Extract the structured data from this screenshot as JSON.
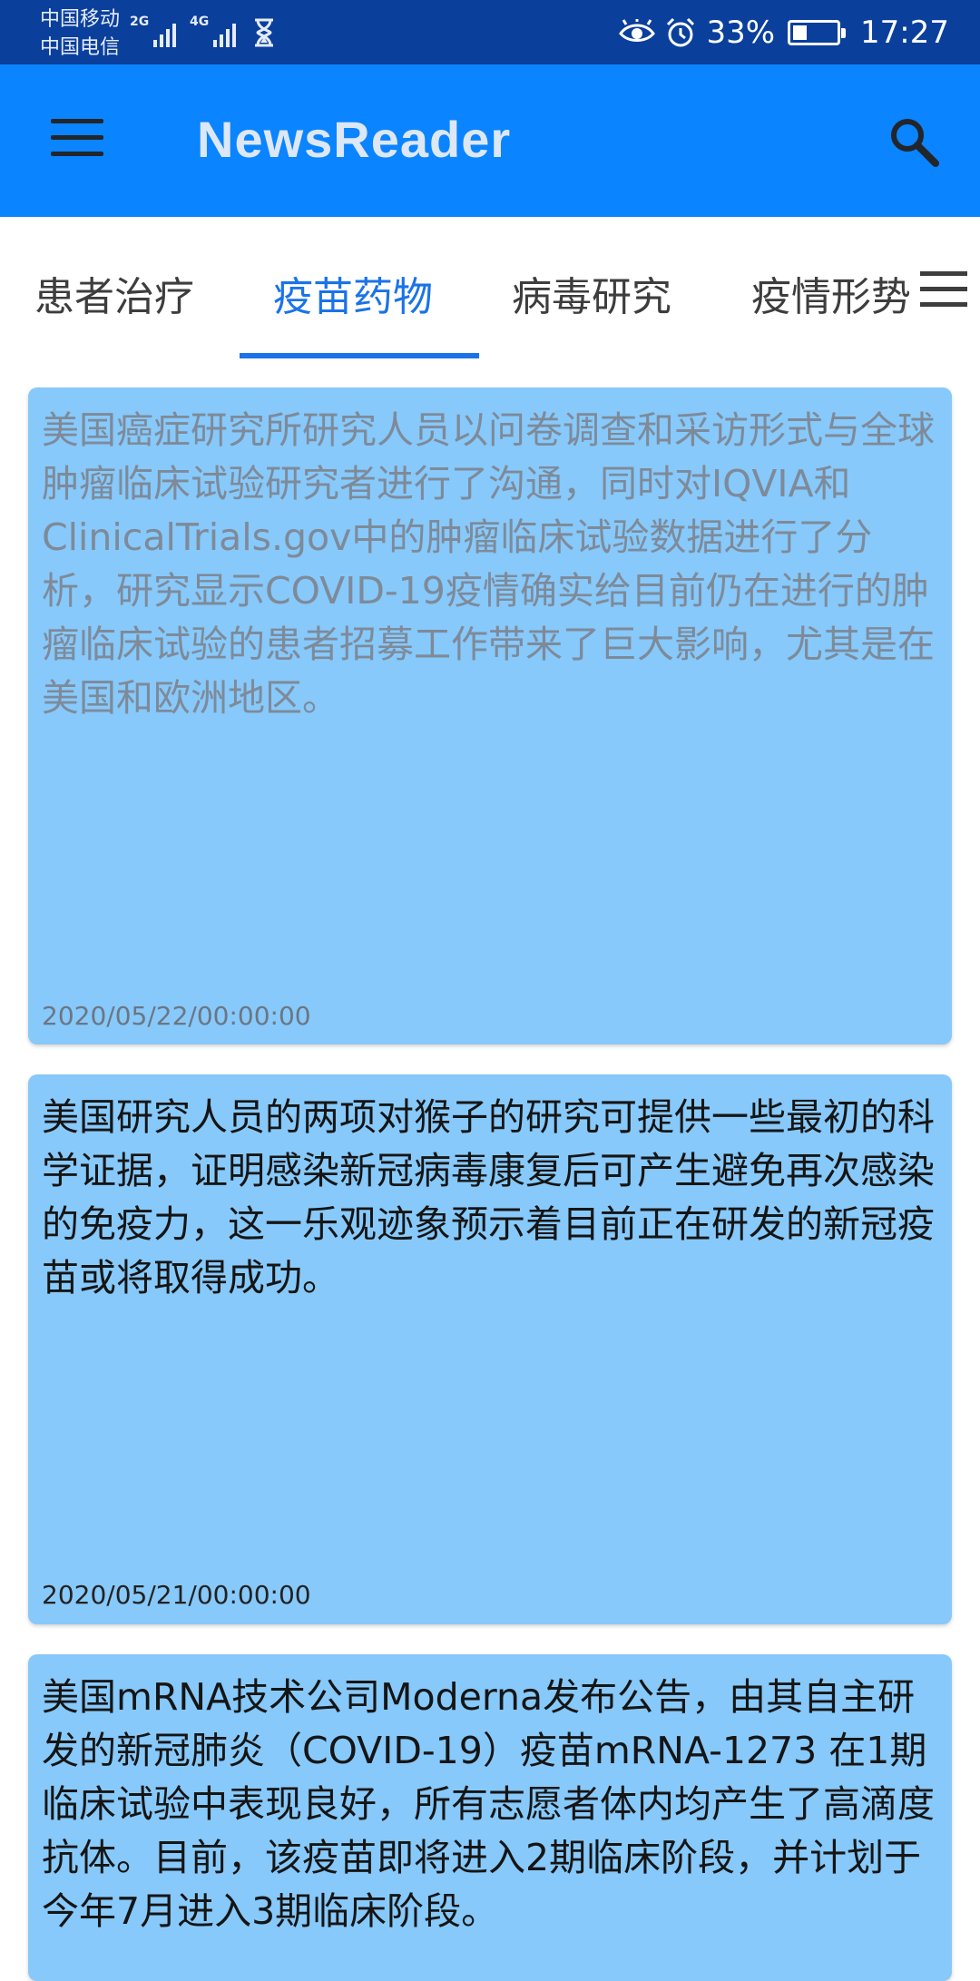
{
  "status_bar": {
    "carrier_1": "中国移动",
    "carrier_2": "中国电信",
    "net_1": "2G",
    "net_2": "4G",
    "battery_percent": "33%",
    "battery_level": 0.33,
    "time": "17:27"
  },
  "app_bar": {
    "title": "NewsReader",
    "menu_icon": "hamburger-menu-icon",
    "search_icon": "search-icon"
  },
  "tabs": {
    "items": [
      {
        "label": "患者治疗"
      },
      {
        "label": "疫苗药物"
      },
      {
        "label": "病毒研究"
      },
      {
        "label": "疫情形势"
      }
    ],
    "active_index": 1,
    "more_icon": "hamburger-menu-icon"
  },
  "news": {
    "items": [
      {
        "content": "美国癌症研究所研究人员以问卷调查和采访形式与全球肿瘤临床试验研究者进行了沟通，同时对IQVIA和ClinicalTrials.gov中的肿瘤临床试验数据进行了分析，研究显示COVID-19疫情确实给目前仍在进行的肿瘤临床试验的患者招募工作带来了巨大影响，尤其是在美国和欧洲地区。",
        "date": "2020/05/22/00:00:00",
        "read": true
      },
      {
        "content": "美国研究人员的两项对猴子的研究可提供一些最初的科学证据，证明感染新冠病毒康复后可产生避免再次感染的免疫力，这一乐观迹象预示着目前正在研发的新冠疫苗或将取得成功。",
        "date": "2020/05/21/00:00:00",
        "read": false
      },
      {
        "content": "美国mRNA技术公司Moderna发布公告，由其自主研发的新冠肺炎（COVID-19）疫苗mRNA-1273 在1期临床试验中表现良好，所有志愿者体内均产生了高滴度抗体。目前，该疫苗即将进入2期临床阶段，并计划于今年7月进入3期临床阶段。",
        "read": false
      }
    ]
  },
  "colors": {
    "status_bar": "#0a3f9c",
    "app_bar": "#0a84ff",
    "card": "#87c9fa",
    "tab_active": "#1a73e8"
  }
}
